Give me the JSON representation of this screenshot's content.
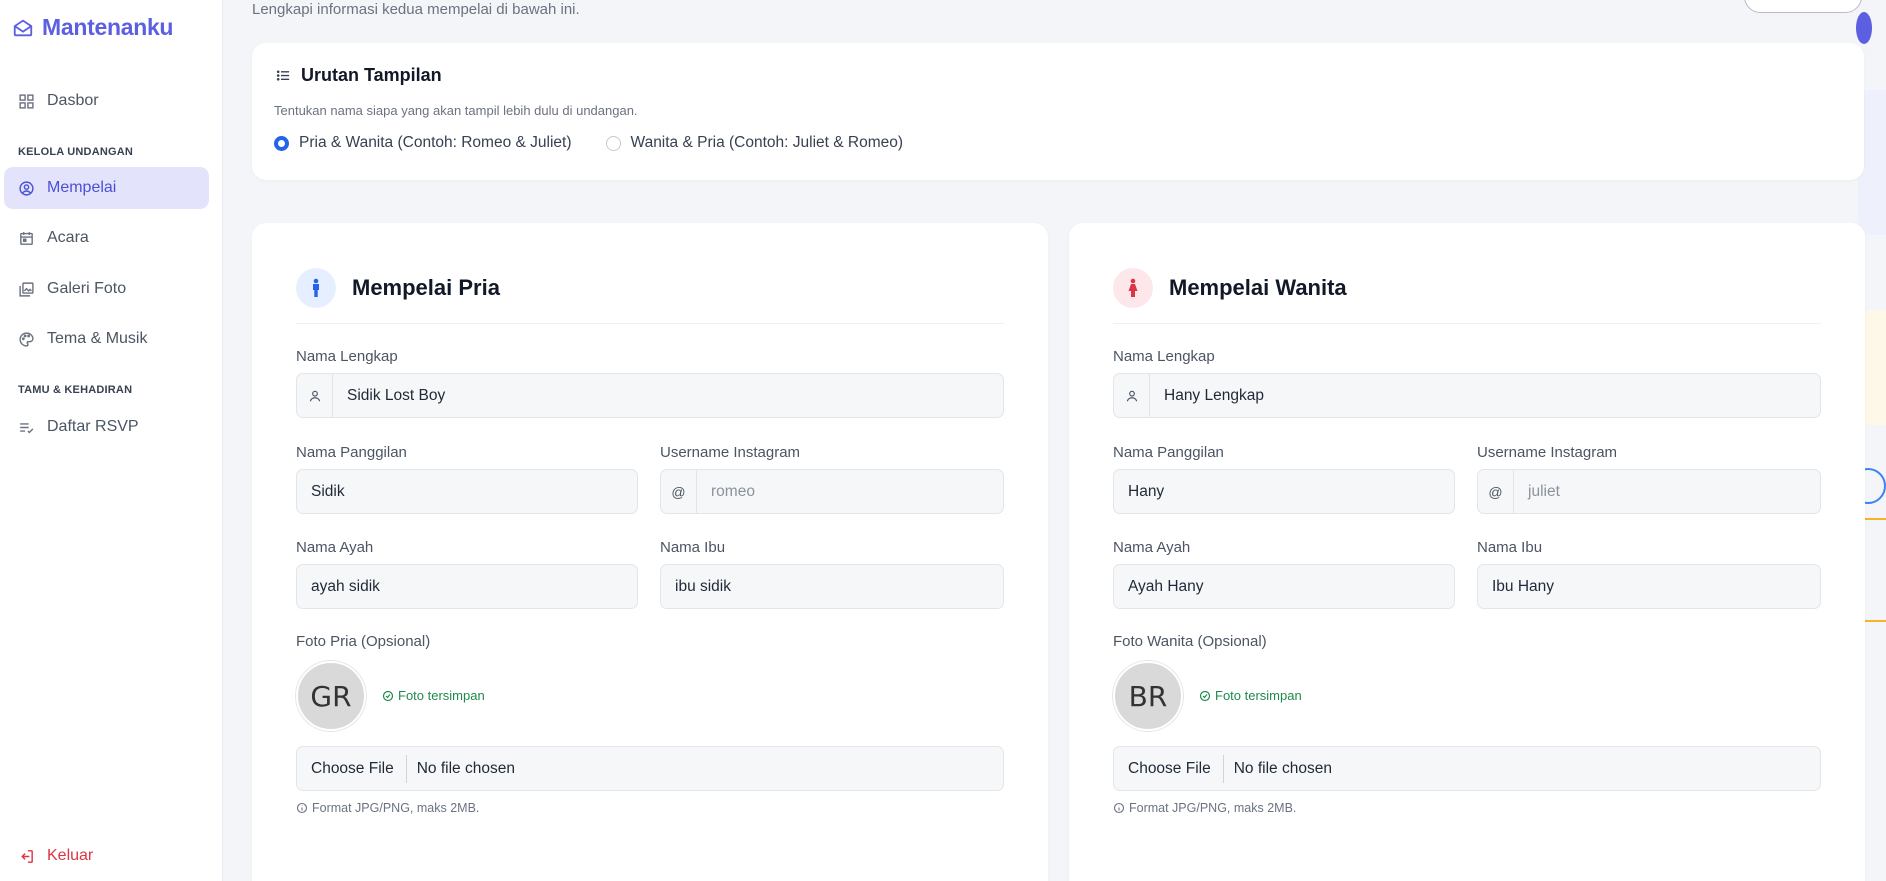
{
  "app": {
    "brand": "Mantenanku",
    "accent": "#5b5fe0"
  },
  "sidebar": {
    "dashboard": "Dasbor",
    "section_invitation": "KELOLA UNDANGAN",
    "items_invitation": [
      {
        "label": "Mempelai",
        "icon": "user-circle-icon",
        "active": true
      },
      {
        "label": "Acara",
        "icon": "calendar-icon",
        "active": false
      },
      {
        "label": "Galeri Foto",
        "icon": "gallery-icon",
        "active": false
      },
      {
        "label": "Tema & Musik",
        "icon": "palette-icon",
        "active": false
      }
    ],
    "section_guests": "TAMU & KEHADIRAN",
    "items_guests": [
      {
        "label": "Daftar RSVP",
        "icon": "list-check-icon",
        "active": false
      }
    ],
    "logout": "Keluar"
  },
  "header": {
    "subtitle": "Lengkapi informasi kedua mempelai di bawah ini."
  },
  "order": {
    "title": "Urutan Tampilan",
    "description": "Tentukan nama siapa yang akan tampil lebih dulu di undangan.",
    "options": [
      {
        "label": "Pria & Wanita (Contoh: Romeo & Juliet)",
        "checked": true
      },
      {
        "label": "Wanita & Pria (Contoh: Juliet & Romeo)",
        "checked": false
      }
    ]
  },
  "labels": {
    "full_name": "Nama Lengkap",
    "nickname": "Nama Panggilan",
    "instagram": "Username Instagram",
    "father": "Nama Ayah",
    "mother": "Nama Ibu",
    "at": "@",
    "choose_file": "Choose File",
    "no_file": "No file chosen",
    "saved": "Foto tersimpan",
    "hint": "Format JPG/PNG, maks 2MB."
  },
  "groom": {
    "title": "Mempelai Pria",
    "full_name": "Sidik Lost Boy",
    "nickname": "Sidik",
    "instagram_placeholder": "romeo",
    "father": "ayah sidik",
    "mother": "ibu sidik",
    "photo_label": "Foto Pria (Opsional)",
    "avatar_initials": "GR",
    "icon_color": "#2563eb"
  },
  "bride": {
    "title": "Mempelai Wanita",
    "full_name": "Hany Lengkap",
    "nickname": "Hany",
    "instagram_placeholder": "juliet",
    "father": "Ayah Hany",
    "mother": "Ibu Hany",
    "photo_label": "Foto Wanita (Opsional)",
    "avatar_initials": "BR",
    "icon_color": "#dc3545"
  }
}
